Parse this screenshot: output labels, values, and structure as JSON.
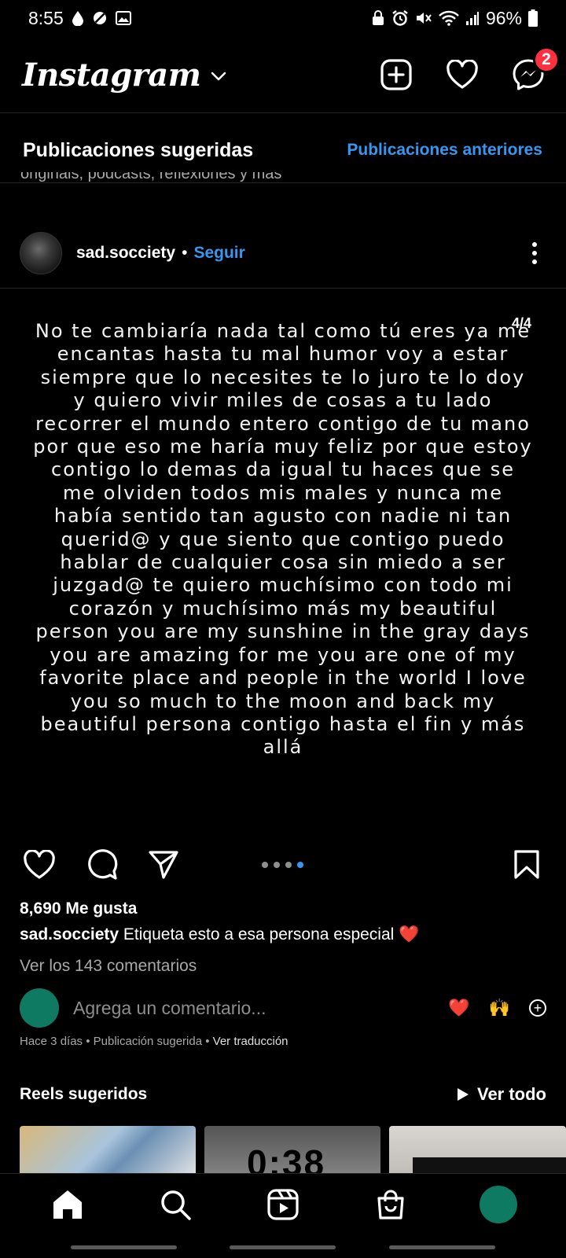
{
  "status_bar": {
    "time": "8:55",
    "battery": "96%"
  },
  "header": {
    "logo": "Instagram",
    "messages_badge": "2"
  },
  "suggested": {
    "title": "Publicaciones sugeridas",
    "previous_link": "Publicaciones anteriores",
    "clipped_text": "originals, podcasts, reflexiones y más"
  },
  "post": {
    "username": "sad.socciety",
    "separator": "•",
    "follow_label": "Seguir",
    "page_counter": "4/4",
    "image_text": "No te cambiaría nada tal como tú eres ya me encantas hasta tu mal humor voy a estar siempre que lo necesites te lo juro te lo doy y quiero vivir miles de cosas a tu lado recorrer el mundo entero contigo de tu mano por que eso me haría muy feliz por que estoy contigo lo demas da igual tu haces que se me olviden todos mis males y nunca me había sentido tan agusto con nadie ni tan querid@ y que siento que contigo puedo hablar de cualquier cosa sin miedo a ser juzgad@ te quiero muchísimo con todo mi corazón y muchísimo más my beautiful person you are my sunshine in the gray days you are amazing for me you are one of my favorite place and people in the world I love you so much to the moon and back my beautiful persona contigo hasta el fin y más allá",
    "carousel_total": 4,
    "carousel_active": 4,
    "likes": "8,690 Me gusta",
    "caption_user": "sad.socciety",
    "caption_text": " Etiqueta esto a esa persona especial ❤️",
    "view_comments": "Ver los 143 comentarios",
    "comment_placeholder": "Agrega un comentario...",
    "quick_emoji_1": "❤️",
    "quick_emoji_2": "🙌",
    "meta_text": "Hace 3 días • Publicación sugerida • ",
    "translate_label": "Ver traducción"
  },
  "reels": {
    "title": "Reels sugeridos",
    "see_all": "Ver todo",
    "thumb_2_time": "0:38"
  },
  "colors": {
    "accent": "#3797f0",
    "badge": "#ff3040",
    "avatar_green": "#0f7a62"
  }
}
